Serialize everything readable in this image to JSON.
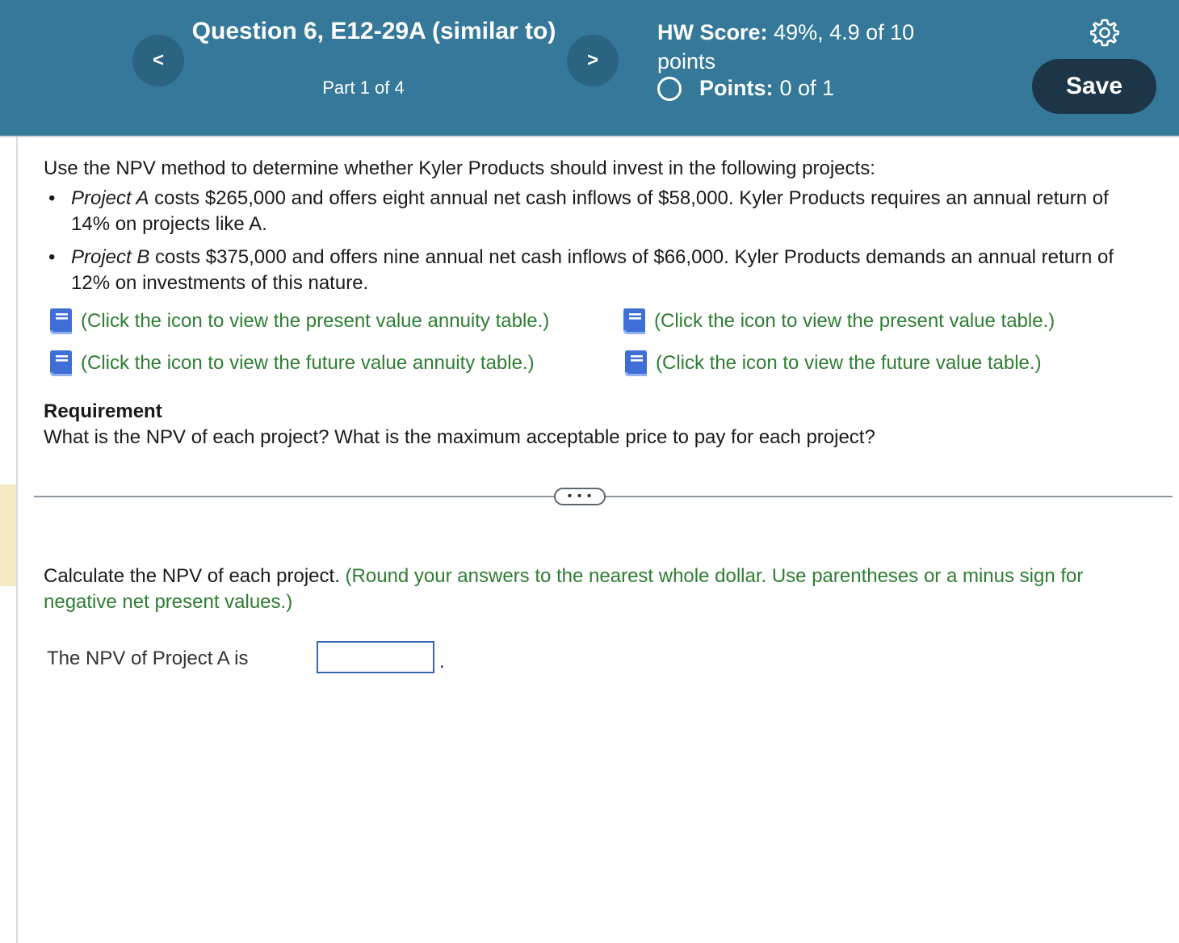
{
  "header": {
    "question_title": "Question 6, E12-29A (similar to)",
    "part": "Part 1 of 4",
    "hw_score_label": "HW Score:",
    "hw_score_value": "49%, 4.9 of 10 points",
    "points_label": "Points:",
    "points_value": "0 of 1",
    "save_label": "Save",
    "prev_symbol": "<",
    "next_symbol": ">"
  },
  "problem": {
    "intro": "Use the NPV method to determine whether Kyler Products should invest in the following projects:",
    "project_a_name": "Project A",
    "project_a_text": "costs $265,000 and offers eight annual net cash inflows of $58,000. Kyler Products requires an annual return of 14% on projects like A.",
    "project_b_name": "Project B",
    "project_b_text": "costs $375,000 and offers nine annual net cash inflows of $66,000. Kyler Products demands an annual return of 12% on investments of this nature."
  },
  "links": {
    "pv_annuity": "(Click the icon to view the present value annuity table.)",
    "pv": "(Click the icon to view the present value table.)",
    "fv_annuity": "(Click the icon to view the future value annuity table.)",
    "fv": "(Click the icon to view the future value table.)"
  },
  "requirement": {
    "title": "Requirement",
    "text": "What is the NPV of each project? What is the maximum acceptable price to pay for each project?"
  },
  "more_label": "• • •",
  "calc": {
    "instruction": "Calculate the NPV of each project.",
    "hint": "(Round your answers to the nearest whole dollar. Use parentheses or a minus sign for negative net present values.)",
    "npv_a_label": "The NPV of Project A is",
    "npv_a_value": "",
    "period": "."
  },
  "colors": {
    "header_bg": "#357899",
    "save_bg": "#1d3647",
    "link_green": "#2e7d32",
    "input_border": "#3a66b7"
  },
  "icons": [
    "chevron-left-icon",
    "chevron-right-icon",
    "gear-icon",
    "radio-circle-icon",
    "book-icon"
  ]
}
